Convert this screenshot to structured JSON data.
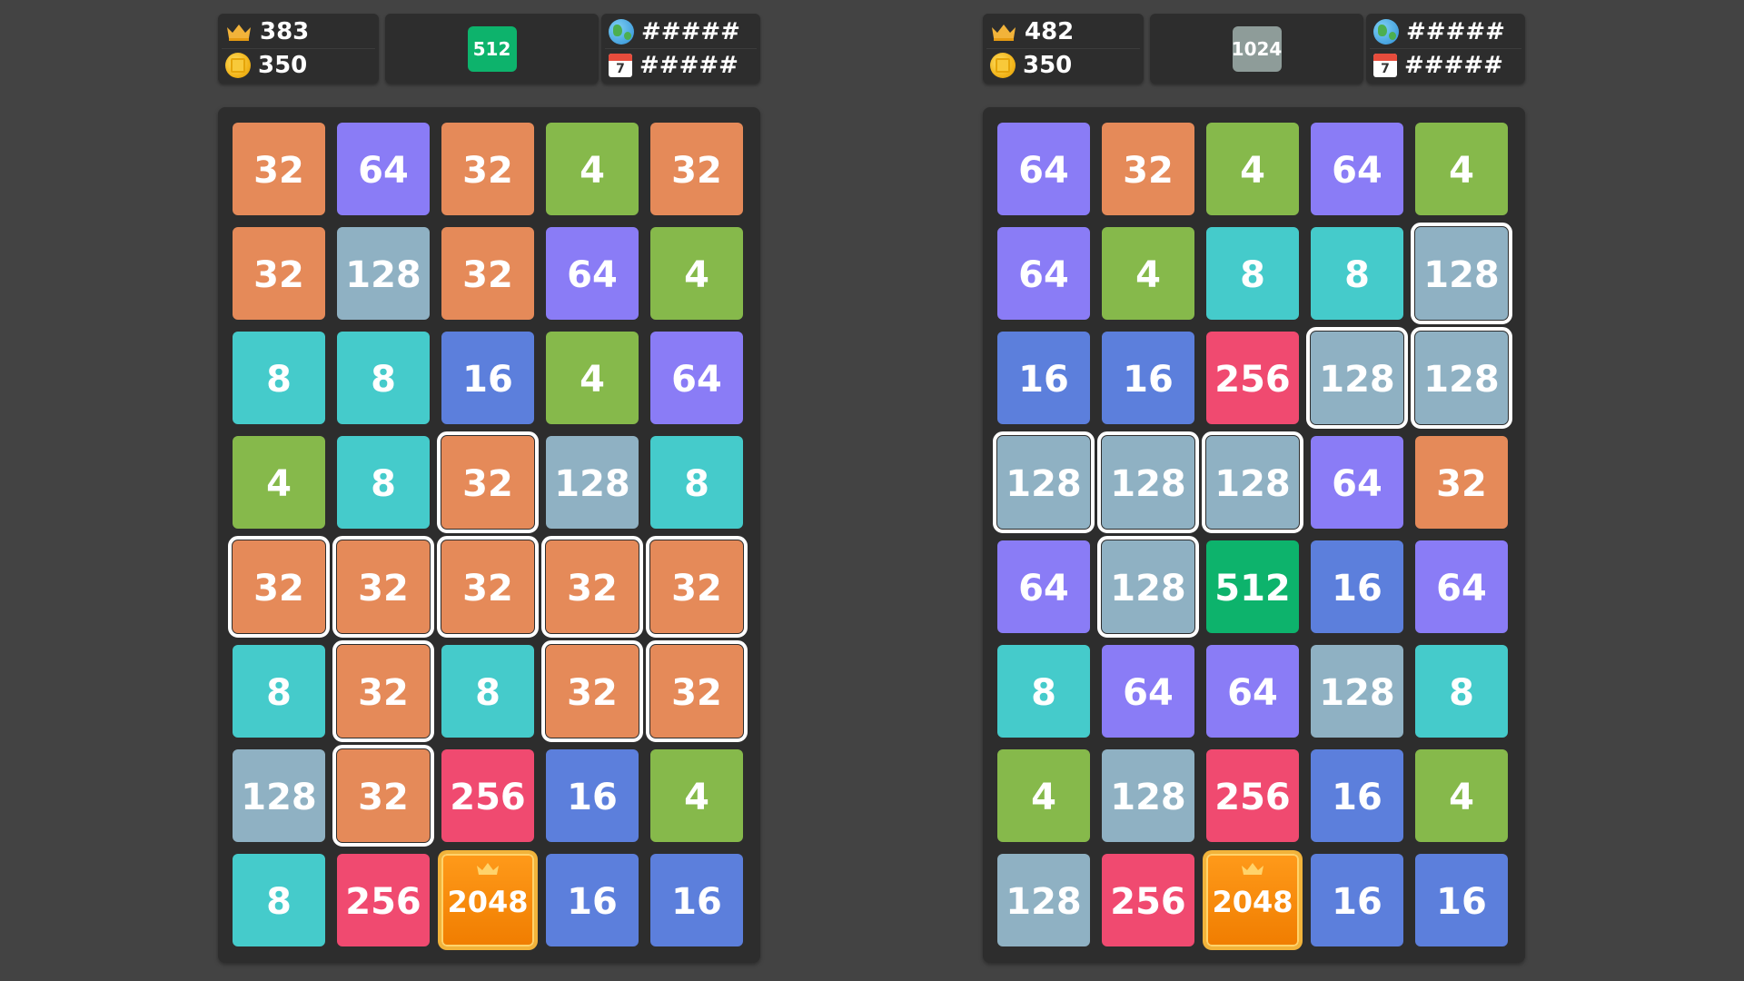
{
  "colors": {
    "background": "#434343",
    "panel": "#2d2d2d",
    "tiles": {
      "4": "#86b94b",
      "8": "#45cbcb",
      "16": "#5c7fdc",
      "32": "#e58a59",
      "64": "#8a7cf6",
      "128": "#8fb1c3",
      "256": "#f04a70",
      "512": "#0db36c",
      "1024": "#8e9c99",
      "2048": "#f58a0a"
    }
  },
  "games": [
    {
      "stats": {
        "crown_value": "383",
        "coin_value": "350"
      },
      "target": {
        "value": "512",
        "color": "#0db36c"
      },
      "rank": {
        "global_value": "#####",
        "daily_value": "#####",
        "calendar_day": "7"
      },
      "board": [
        [
          {
            "v": "32"
          },
          {
            "v": "64"
          },
          {
            "v": "32"
          },
          {
            "v": "4"
          },
          {
            "v": "32"
          }
        ],
        [
          {
            "v": "32"
          },
          {
            "v": "128"
          },
          {
            "v": "32"
          },
          {
            "v": "64"
          },
          {
            "v": "4"
          }
        ],
        [
          {
            "v": "8"
          },
          {
            "v": "8"
          },
          {
            "v": "16"
          },
          {
            "v": "4"
          },
          {
            "v": "64"
          }
        ],
        [
          {
            "v": "4"
          },
          {
            "v": "8"
          },
          {
            "v": "32",
            "hl": true
          },
          {
            "v": "128"
          },
          {
            "v": "8"
          }
        ],
        [
          {
            "v": "32",
            "hl": true
          },
          {
            "v": "32",
            "hl": true
          },
          {
            "v": "32",
            "hl": true
          },
          {
            "v": "32",
            "hl": true
          },
          {
            "v": "32",
            "hl": true
          }
        ],
        [
          {
            "v": "8"
          },
          {
            "v": "32",
            "hl": true
          },
          {
            "v": "8"
          },
          {
            "v": "32",
            "hl": true
          },
          {
            "v": "32",
            "hl": true
          }
        ],
        [
          {
            "v": "128"
          },
          {
            "v": "32",
            "hl": true
          },
          {
            "v": "256"
          },
          {
            "v": "16"
          },
          {
            "v": "4"
          }
        ],
        [
          {
            "v": "8"
          },
          {
            "v": "256"
          },
          {
            "v": "2048",
            "big": true
          },
          {
            "v": "16"
          },
          {
            "v": "16"
          }
        ]
      ]
    },
    {
      "stats": {
        "crown_value": "482",
        "coin_value": "350"
      },
      "target": {
        "value": "1024",
        "color": "#8e9c99"
      },
      "rank": {
        "global_value": "#####",
        "daily_value": "#####",
        "calendar_day": "7"
      },
      "board": [
        [
          {
            "v": "64"
          },
          {
            "v": "32"
          },
          {
            "v": "4"
          },
          {
            "v": "64"
          },
          {
            "v": "4"
          }
        ],
        [
          {
            "v": "64"
          },
          {
            "v": "4"
          },
          {
            "v": "8"
          },
          {
            "v": "8"
          },
          {
            "v": "128",
            "hl": true
          }
        ],
        [
          {
            "v": "16"
          },
          {
            "v": "16"
          },
          {
            "v": "256"
          },
          {
            "v": "128",
            "hl": true
          },
          {
            "v": "128",
            "hl": true
          }
        ],
        [
          {
            "v": "128",
            "hl": true
          },
          {
            "v": "128",
            "hl": true
          },
          {
            "v": "128",
            "hl": true
          },
          {
            "v": "64"
          },
          {
            "v": "32"
          }
        ],
        [
          {
            "v": "64"
          },
          {
            "v": "128",
            "hl": true
          },
          {
            "v": "512"
          },
          {
            "v": "16"
          },
          {
            "v": "64"
          }
        ],
        [
          {
            "v": "8"
          },
          {
            "v": "64"
          },
          {
            "v": "64"
          },
          {
            "v": "128"
          },
          {
            "v": "8"
          }
        ],
        [
          {
            "v": "4"
          },
          {
            "v": "128"
          },
          {
            "v": "256"
          },
          {
            "v": "16"
          },
          {
            "v": "4"
          }
        ],
        [
          {
            "v": "128"
          },
          {
            "v": "256"
          },
          {
            "v": "2048",
            "big": true
          },
          {
            "v": "16"
          },
          {
            "v": "16"
          }
        ]
      ]
    }
  ]
}
